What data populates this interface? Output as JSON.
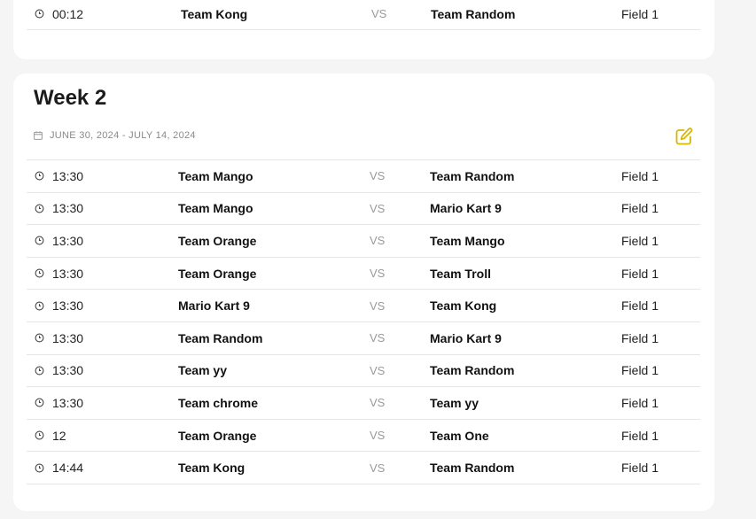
{
  "previous_week": {
    "matches": [
      {
        "time": "00:12",
        "home": "Team Kong",
        "vs": "VS",
        "away": "Team Random",
        "field": "Field 1"
      }
    ]
  },
  "week": {
    "title": "Week 2",
    "date_range": "JUNE 30, 2024 - JULY 14, 2024",
    "icons": {
      "date": "calendar-icon",
      "edit": "edit-icon",
      "time": "clock-icon"
    },
    "accent_color": "#d8b700",
    "matches": [
      {
        "time": "13:30",
        "home": "Team Mango",
        "vs": "VS",
        "away": "Team Random",
        "field": "Field 1"
      },
      {
        "time": "13:30",
        "home": "Team Mango",
        "vs": "VS",
        "away": "Mario Kart 9",
        "field": "Field 1"
      },
      {
        "time": "13:30",
        "home": "Team Orange",
        "vs": "VS",
        "away": "Team Mango",
        "field": "Field 1"
      },
      {
        "time": "13:30",
        "home": "Team Orange",
        "vs": "VS",
        "away": "Team Troll",
        "field": "Field 1"
      },
      {
        "time": "13:30",
        "home": "Mario Kart 9",
        "vs": "VS",
        "away": "Team Kong",
        "field": "Field 1"
      },
      {
        "time": "13:30",
        "home": "Team Random",
        "vs": "VS",
        "away": "Mario Kart 9",
        "field": "Field 1"
      },
      {
        "time": "13:30",
        "home": "Team yy",
        "vs": "VS",
        "away": "Team Random",
        "field": "Field 1"
      },
      {
        "time": "13:30",
        "home": "Team chrome",
        "vs": "VS",
        "away": "Team yy",
        "field": "Field 1"
      },
      {
        "time": "12",
        "home": "Team Orange",
        "vs": "VS",
        "away": "Team One",
        "field": "Field 1"
      },
      {
        "time": "14:44",
        "home": "Team Kong",
        "vs": "VS",
        "away": "Team Random",
        "field": "Field 1"
      }
    ]
  }
}
